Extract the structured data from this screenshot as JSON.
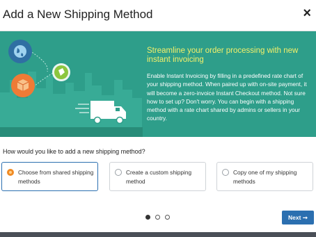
{
  "modal": {
    "title": "Add a New Shipping Method",
    "close_glyph": "×"
  },
  "banner": {
    "headline": "Streamline your order processing with new instant invoicing",
    "body": "Enable Instant Invoicing by filling in a predefined rate chart of your shipping method. When paired up with on-site payment, it will become a zero-invoice Instant Checkout method. Not sure how to set up? Don't worry. You can begin with a shipping method with a rate chart shared by admins or sellers in your country.",
    "icons": [
      "globe-icon",
      "package-icon",
      "tag-icon",
      "delivery-truck-icon"
    ],
    "colors": {
      "background": "#2e9e8a",
      "headline": "#f3f06a"
    }
  },
  "question": "How would you like to add a new shipping method?",
  "options": [
    {
      "label": "Choose from shared shipping methods",
      "selected": true
    },
    {
      "label": "Create a custom shipping method",
      "selected": false
    },
    {
      "label": "Copy one of my shipping methods",
      "selected": false
    }
  ],
  "pagination": {
    "current": 1,
    "total": 3
  },
  "footer": {
    "next_label": "Next ➞"
  },
  "colors": {
    "accent": "#2b6fb0",
    "radio_selected": "#f08a24"
  }
}
